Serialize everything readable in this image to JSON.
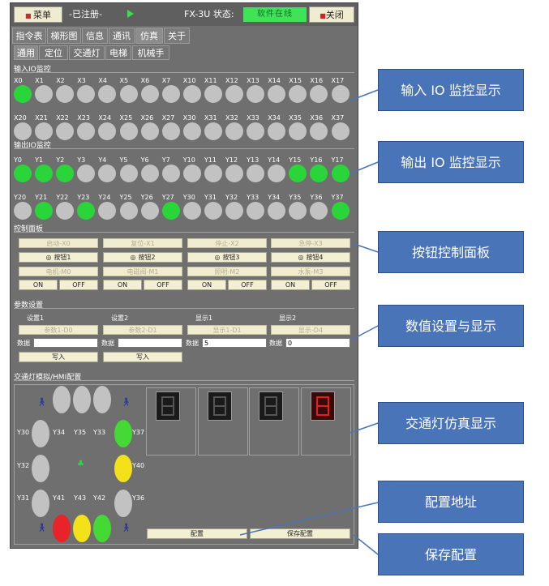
{
  "toolbar": {
    "menu_label": "菜单",
    "registered": "-已注册-",
    "model_status": "FX-3U 状态:",
    "status_badge": "软件在线",
    "close_label": "关闭"
  },
  "tabs": [
    "指令表",
    "梯形图",
    "信息",
    "通讯",
    "仿真",
    "关于"
  ],
  "subtabs": [
    "通用",
    "定位",
    "交通灯",
    "电梯",
    "机械手"
  ],
  "input_section": {
    "title": "输入IO监控",
    "row1_labels": [
      "X0",
      "X1",
      "X2",
      "X3",
      "X4",
      "X5",
      "X6",
      "X7",
      "X10",
      "X11",
      "X12",
      "X13",
      "X14",
      "X15",
      "X16",
      "X17"
    ],
    "row1_states": [
      1,
      0,
      0,
      0,
      0,
      0,
      0,
      0,
      0,
      0,
      0,
      0,
      0,
      0,
      0,
      0
    ],
    "row2_labels": [
      "X20",
      "X21",
      "X22",
      "X23",
      "X24",
      "X25",
      "X26",
      "X27",
      "X30",
      "X31",
      "X32",
      "X33",
      "X34",
      "X35",
      "X36",
      "X37"
    ],
    "row2_states": [
      0,
      0,
      0,
      0,
      0,
      0,
      0,
      0,
      0,
      0,
      0,
      0,
      0,
      0,
      0,
      0
    ]
  },
  "output_section": {
    "title": "输出IO监控",
    "row1_labels": [
      "Y0",
      "Y1",
      "Y2",
      "Y3",
      "Y4",
      "Y5",
      "Y6",
      "Y7",
      "Y10",
      "Y11",
      "Y12",
      "Y13",
      "Y14",
      "Y15",
      "Y16",
      "Y17"
    ],
    "row1_states": [
      1,
      1,
      1,
      0,
      0,
      0,
      0,
      0,
      0,
      0,
      0,
      0,
      0,
      1,
      1,
      1
    ],
    "row2_labels": [
      "Y20",
      "Y21",
      "Y22",
      "Y23",
      "Y24",
      "Y25",
      "Y26",
      "Y27",
      "Y30",
      "Y31",
      "Y32",
      "Y33",
      "Y34",
      "Y35",
      "Y36",
      "Y37"
    ],
    "row2_states": [
      0,
      1,
      0,
      1,
      0,
      0,
      0,
      1,
      0,
      0,
      0,
      0,
      0,
      0,
      0,
      1
    ]
  },
  "control_panel": {
    "title": "控制面板",
    "top_labels": [
      "启动-X0",
      "复位-X1",
      "停止-X2",
      "急停-X3"
    ],
    "buttons": [
      "按钮1",
      "按钮2",
      "按钮3",
      "按钮4"
    ],
    "mid_labels": [
      "电机-M0",
      "电磁阀-M1",
      "照明-M2",
      "水泵-M3"
    ],
    "on_label": "ON",
    "off_label": "OFF"
  },
  "params": {
    "title": "参数设置",
    "headers": [
      "设置1",
      "设置2",
      "显示1",
      "显示2"
    ],
    "fields": [
      "参数1-D0",
      "参数2-D1",
      "显示1-D1",
      "显示-D4"
    ],
    "data_label": "数据",
    "values": [
      "",
      "",
      "5",
      "0"
    ],
    "write_label": "写入"
  },
  "traffic": {
    "title": "交通灯模拟/HMI配置",
    "labels": [
      "Y30",
      "Y34",
      "Y35",
      "Y33",
      "Y37",
      "Y32",
      "Y40",
      "Y31",
      "Y41",
      "Y43",
      "Y42",
      "Y36"
    ],
    "digit": "5",
    "config_label": "配置",
    "save_label": "保存配置"
  },
  "callouts": [
    "输入 IO 监控显示",
    "输出 IO 监控显示",
    "按钮控制面板",
    "数值设置与显示",
    "交通灯仿真显示",
    "配置地址",
    "保存配置"
  ],
  "colors": {
    "led_on": "#2ad53a",
    "led_off": "#c2c2c2",
    "red": "#e8232a",
    "yellow": "#f3e11a",
    "green": "#44d934",
    "callout_bg": "#4a74b8"
  }
}
